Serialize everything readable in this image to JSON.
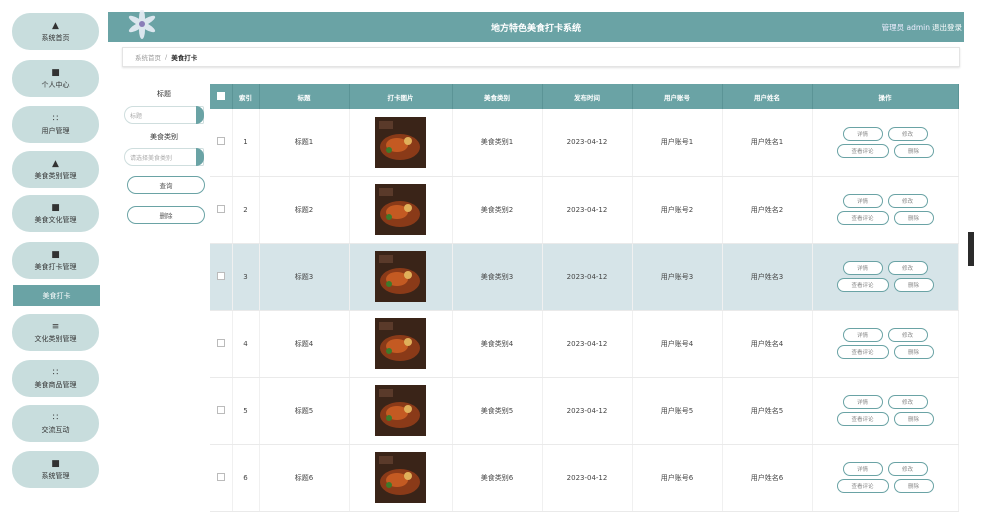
{
  "header": {
    "title": "地方特色美食打卡系统",
    "user": "管理员 admin",
    "logout": "退出登录"
  },
  "breadcrumb": {
    "home": "系统首页",
    "separator": "/",
    "current": "美食打卡"
  },
  "sidebar": {
    "items": [
      {
        "icon": "▲",
        "label": "系统首页"
      },
      {
        "icon": "■",
        "label": "个人中心"
      },
      {
        "icon": "∷",
        "label": "用户管理"
      },
      {
        "icon": "▲",
        "label": "美食类别管理"
      },
      {
        "icon": "■",
        "label": "美食文化管理"
      },
      {
        "icon": "■",
        "label": "美食打卡管理"
      },
      {
        "icon": "≡",
        "label": "文化类别管理"
      },
      {
        "icon": "∷",
        "label": "美食商品管理"
      },
      {
        "icon": "∷",
        "label": "交流互动"
      },
      {
        "icon": "■",
        "label": "系统管理"
      }
    ],
    "active_sub": "美食打卡"
  },
  "filters": {
    "title_label": "标题",
    "title_placeholder": "标题",
    "category_label": "美食类别",
    "category_placeholder": "请选择美食类别",
    "query_button": "查询",
    "delete_button": "删除"
  },
  "table": {
    "headers": [
      "",
      "索引",
      "标题",
      "打卡图片",
      "美食类别",
      "发布时间",
      "用户账号",
      "用户姓名",
      "操作"
    ],
    "rows": [
      {
        "index": "1",
        "title": "标题1",
        "category": "美食类别1",
        "time": "2023-04-12",
        "account": "用户账号1",
        "name": "用户姓名1"
      },
      {
        "index": "2",
        "title": "标题2",
        "category": "美食类别2",
        "time": "2023-04-12",
        "account": "用户账号2",
        "name": "用户姓名2"
      },
      {
        "index": "3",
        "title": "标题3",
        "category": "美食类别3",
        "time": "2023-04-12",
        "account": "用户账号3",
        "name": "用户姓名3"
      },
      {
        "index": "4",
        "title": "标题4",
        "category": "美食类别4",
        "time": "2023-04-12",
        "account": "用户账号4",
        "name": "用户姓名4"
      },
      {
        "index": "5",
        "title": "标题5",
        "category": "美食类别5",
        "time": "2023-04-12",
        "account": "用户账号5",
        "name": "用户姓名5"
      },
      {
        "index": "6",
        "title": "标题6",
        "category": "美食类别6",
        "time": "2023-04-12",
        "account": "用户账号6",
        "name": "用户姓名6"
      }
    ],
    "actions": {
      "detail": "详情",
      "edit": "修改",
      "comments": "查看评论",
      "delete": "删除"
    }
  },
  "colors": {
    "accent": "#6aa3a5",
    "nav_bg": "#c8dddd",
    "row_highlight": "#d6e4e8"
  }
}
